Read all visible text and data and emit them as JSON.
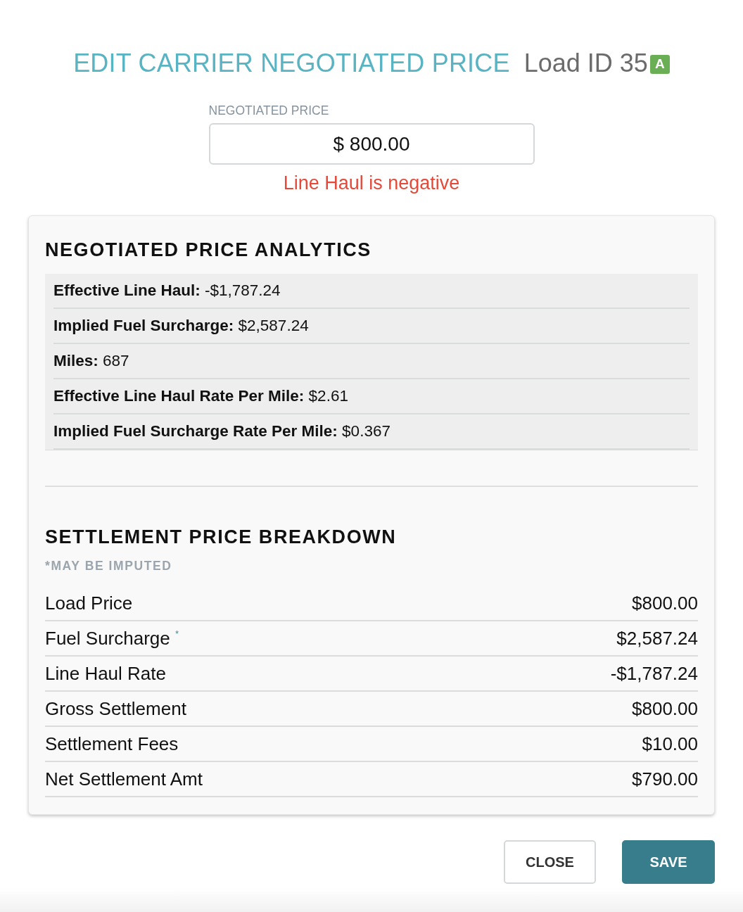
{
  "dialog": {
    "title": "EDIT CARRIER NEGOTIATED PRICE",
    "subtitle": "Load ID 35",
    "badge": "A"
  },
  "negotiated_price": {
    "label": "NEGOTIATED PRICE",
    "value": "$ 800.00",
    "error": "Line Haul is negative"
  },
  "analytics": {
    "title": "NEGOTIATED PRICE ANALYTICS",
    "rows": [
      "**Effective Line Haul:** -$1,787.24",
      "**Implied Fuel Surcharge:** $2,587.24",
      "**Miles:** 687",
      "**Effective Line Haul Rate Per Mile:** $2.61",
      "**Implied Fuel Surcharge Rate Per Mile:** $0.367"
    ]
  },
  "breakdown": {
    "title": "SETTLEMENT PRICE BREAKDOWN",
    "note": "*MAY BE IMPUTED",
    "rows": [
      {
        "label": "Load Price",
        "value": "$800.00"
      },
      {
        "label": "Fuel Surcharge $^{*}$",
        "value": "$2,587.24"
      },
      {
        "label": "Line Haul Rate",
        "value": "-$1,787.24"
      },
      {
        "label": "Gross Settlement",
        "value": "$800.00"
      },
      {
        "label": "Settlement Fees",
        "value": "$10.00"
      },
      {
        "label": "Net Settlement Amt",
        "value": "$790.00"
      }
    ]
  },
  "buttons": [
    {
      "label": "CLOSE",
      "kind": "secondary"
    },
    {
      "label": "SAVE",
      "kind": "primary"
    }
  ]
}
